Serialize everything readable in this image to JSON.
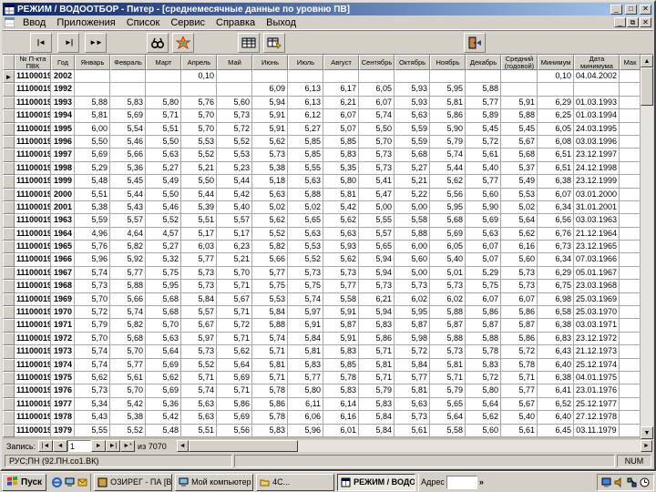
{
  "window": {
    "title": "РЕЖИМ / ВОДООТБОР - Питер - [среднемесячные данные по уровню ПВ]"
  },
  "menu": {
    "items": [
      {
        "label": "Ввод",
        "name": "vvod"
      },
      {
        "label": "Приложения",
        "name": "prilozheniya"
      },
      {
        "label": "Список",
        "name": "spisok"
      },
      {
        "label": "Сервис",
        "name": "servis"
      },
      {
        "label": "Справка",
        "name": "spravka"
      },
      {
        "label": "Выход",
        "name": "vykhod"
      }
    ]
  },
  "toolbar": {
    "buttons": [
      {
        "name": "first-record"
      },
      {
        "name": "last-record"
      },
      {
        "name": "fast-forward"
      },
      {
        "name": "find"
      },
      {
        "name": "wizard"
      },
      {
        "name": "table"
      },
      {
        "name": "query"
      },
      {
        "name": "exit"
      }
    ]
  },
  "grid": {
    "headers": [
      "",
      "№ П-кта ПВК",
      "Год",
      "Январь",
      "Февраль",
      "Март",
      "Апрель",
      "Май",
      "Июнь",
      "Июль",
      "Август",
      "Сентябрь",
      "Октябрь",
      "Ноябрь",
      "Декабрь",
      "Средний (годовой)",
      "Минимум",
      "Дата минимума",
      "Мак"
    ],
    "current_row_index": 0,
    "rows": [
      {
        "num": "11100019",
        "year": "2002",
        "m": [
          "",
          "",
          "",
          "0,10",
          "",
          "",
          "",
          "",
          "",
          "",
          "",
          ""
        ],
        "avg": "",
        "min": "0,10",
        "date": "04.04.2002",
        "mak": ""
      },
      {
        "num": "11100019",
        "year": "1992",
        "m": [
          "",
          "",
          "",
          "",
          "",
          "6,09",
          "6,13",
          "6,17",
          "6,05",
          "5,93",
          "5,95",
          "5,88"
        ],
        "avg": "",
        "min": "",
        "date": "",
        "mak": ""
      },
      {
        "num": "11100019",
        "year": "1993",
        "m": [
          "5,88",
          "5,83",
          "5,80",
          "5,76",
          "5,60",
          "5,94",
          "6,13",
          "6,21",
          "6,07",
          "5,93",
          "5,81",
          "5,77"
        ],
        "avg": "5,91",
        "min": "6,29",
        "date": "01.03.1993",
        "mak": ""
      },
      {
        "num": "11100019",
        "year": "1994",
        "m": [
          "5,81",
          "5,69",
          "5,71",
          "5,70",
          "5,73",
          "5,91",
          "6,12",
          "6,07",
          "5,74",
          "5,63",
          "5,86",
          "5,89"
        ],
        "avg": "5,88",
        "min": "6,25",
        "date": "01.03.1994",
        "mak": ""
      },
      {
        "num": "11100019",
        "year": "1995",
        "m": [
          "6,00",
          "5,54",
          "5,51",
          "5,70",
          "5,72",
          "5,91",
          "5,27",
          "5,07",
          "5,50",
          "5,59",
          "5,90",
          "5,45"
        ],
        "avg": "5,45",
        "min": "6,05",
        "date": "24.03.1995",
        "mak": ""
      },
      {
        "num": "11100019",
        "year": "1996",
        "m": [
          "5,50",
          "5,46",
          "5,50",
          "5,53",
          "5,52",
          "5,62",
          "5,85",
          "5,85",
          "5,70",
          "5,59",
          "5,79",
          "5,72"
        ],
        "avg": "5,67",
        "min": "6,08",
        "date": "03.03.1996",
        "mak": ""
      },
      {
        "num": "11100019",
        "year": "1997",
        "m": [
          "5,69",
          "5,66",
          "5,63",
          "5,52",
          "5,53",
          "5,73",
          "5,85",
          "5,83",
          "5,73",
          "5,68",
          "5,74",
          "5,61"
        ],
        "avg": "5,68",
        "min": "6,51",
        "date": "23.12.1997",
        "mak": ""
      },
      {
        "num": "11100019",
        "year": "1998",
        "m": [
          "5,29",
          "5,36",
          "5,27",
          "5,21",
          "5,23",
          "5,38",
          "5,55",
          "5,35",
          "5,73",
          "5,27",
          "5,44",
          "5,40"
        ],
        "avg": "5,37",
        "min": "6,51",
        "date": "24.12.1998",
        "mak": ""
      },
      {
        "num": "11100019",
        "year": "1999",
        "m": [
          "5,48",
          "5,45",
          "5,49",
          "5,50",
          "5,44",
          "5,18",
          "5,63",
          "5,80",
          "5,41",
          "5,21",
          "5,62",
          "5,77"
        ],
        "avg": "5,49",
        "min": "6,38",
        "date": "23.12.1999",
        "mak": ""
      },
      {
        "num": "11100019",
        "year": "2000",
        "m": [
          "5,51",
          "5,44",
          "5,50",
          "5,44",
          "5,42",
          "5,63",
          "5,88",
          "5,81",
          "5,47",
          "5,22",
          "5,56",
          "5,60"
        ],
        "avg": "5,53",
        "min": "6,07",
        "date": "03.01.2000",
        "mak": ""
      },
      {
        "num": "11100019",
        "year": "2001",
        "m": [
          "5,38",
          "5,43",
          "5,46",
          "5,39",
          "5,40",
          "5,02",
          "5,02",
          "5,42",
          "5,00",
          "5,00",
          "5,95",
          "5,90"
        ],
        "avg": "5,02",
        "min": "6,34",
        "date": "31.01.2001",
        "mak": ""
      },
      {
        "num": "11100019",
        "year": "1963",
        "m": [
          "5,59",
          "5,57",
          "5,52",
          "5,51",
          "5,57",
          "5,62",
          "5,65",
          "5,62",
          "5,55",
          "5,58",
          "5,68",
          "5,69"
        ],
        "avg": "5,64",
        "min": "6,56",
        "date": "03.03.1963",
        "mak": ""
      },
      {
        "num": "11100019",
        "year": "1964",
        "m": [
          "4,96",
          "4,64",
          "4,57",
          "5,17",
          "5,17",
          "5,52",
          "5,63",
          "5,63",
          "5,57",
          "5,88",
          "5,69",
          "5,63"
        ],
        "avg": "5,62",
        "min": "6,76",
        "date": "21.12.1964",
        "mak": ""
      },
      {
        "num": "11100019",
        "year": "1965",
        "m": [
          "5,76",
          "5,82",
          "5,27",
          "6,03",
          "6,23",
          "5,82",
          "5,53",
          "5,93",
          "5,65",
          "6,00",
          "6,05",
          "6,07"
        ],
        "avg": "6,16",
        "min": "6,73",
        "date": "23.12.1965",
        "mak": ""
      },
      {
        "num": "11100019",
        "year": "1966",
        "m": [
          "5,96",
          "5,92",
          "5,32",
          "5,77",
          "5,21",
          "5,66",
          "5,52",
          "5,62",
          "5,94",
          "5,60",
          "5,40",
          "5,07"
        ],
        "avg": "5,60",
        "min": "6,34",
        "date": "07.03.1966",
        "mak": ""
      },
      {
        "num": "11100019",
        "year": "1967",
        "m": [
          "5,74",
          "5,77",
          "5,75",
          "5,73",
          "5,70",
          "5,77",
          "5,73",
          "5,73",
          "5,94",
          "5,00",
          "5,01",
          "5,29"
        ],
        "avg": "5,73",
        "min": "6,29",
        "date": "05.01.1967",
        "mak": ""
      },
      {
        "num": "11100019",
        "year": "1968",
        "m": [
          "5,73",
          "5,88",
          "5,95",
          "5,73",
          "5,71",
          "5,75",
          "5,75",
          "5,77",
          "5,73",
          "5,73",
          "5,73",
          "5,75"
        ],
        "avg": "5,73",
        "min": "6,75",
        "date": "23.03.1968",
        "mak": ""
      },
      {
        "num": "11100019",
        "year": "1969",
        "m": [
          "5,70",
          "5,66",
          "5,68",
          "5,84",
          "5,67",
          "5,53",
          "5,74",
          "5,58",
          "6,21",
          "6,02",
          "6,02",
          "6,07"
        ],
        "avg": "6,07",
        "min": "6,98",
        "date": "25.03.1969",
        "mak": ""
      },
      {
        "num": "11100019",
        "year": "1970",
        "m": [
          "5,72",
          "5,74",
          "5,68",
          "5,57",
          "5,71",
          "5,84",
          "5,97",
          "5,91",
          "5,94",
          "5,95",
          "5,88",
          "5,86"
        ],
        "avg": "5,86",
        "min": "6,58",
        "date": "25.03.1970",
        "mak": ""
      },
      {
        "num": "11100019",
        "year": "1971",
        "m": [
          "5,79",
          "5,82",
          "5,70",
          "5,67",
          "5,72",
          "5,88",
          "5,91",
          "5,87",
          "5,83",
          "5,87",
          "5,87",
          "5,87"
        ],
        "avg": "5,87",
        "min": "6,38",
        "date": "03.03.1971",
        "mak": ""
      },
      {
        "num": "11100019",
        "year": "1972",
        "m": [
          "5,70",
          "5,68",
          "5,63",
          "5,97",
          "5,71",
          "5,74",
          "5,84",
          "5,91",
          "5,86",
          "5,98",
          "5,88",
          "5,88"
        ],
        "avg": "5,86",
        "min": "6,83",
        "date": "23.12.1972",
        "mak": ""
      },
      {
        "num": "11100019",
        "year": "1973",
        "m": [
          "5,74",
          "5,70",
          "5,64",
          "5,73",
          "5,62",
          "5,71",
          "5,81",
          "5,83",
          "5,71",
          "5,72",
          "5,73",
          "5,78"
        ],
        "avg": "5,72",
        "min": "6,43",
        "date": "21.12.1973",
        "mak": ""
      },
      {
        "num": "11100019",
        "year": "1974",
        "m": [
          "5,74",
          "5,77",
          "5,69",
          "5,52",
          "5,64",
          "5,81",
          "5,83",
          "5,85",
          "5,81",
          "5,84",
          "5,81",
          "5,83"
        ],
        "avg": "5,78",
        "min": "6,40",
        "date": "25.12.1974",
        "mak": ""
      },
      {
        "num": "11100019",
        "year": "1975",
        "m": [
          "5,62",
          "5,61",
          "5,62",
          "5,71",
          "5,69",
          "5,71",
          "5,77",
          "5,78",
          "5,71",
          "5,77",
          "5,71",
          "5,72"
        ],
        "avg": "5,71",
        "min": "6,38",
        "date": "04.01.1975",
        "mak": ""
      },
      {
        "num": "11100019",
        "year": "1976",
        "m": [
          "5,73",
          "5,70",
          "5,69",
          "5,74",
          "5,71",
          "5,78",
          "5,80",
          "5,83",
          "5,79",
          "5,81",
          "5,79",
          "5,80"
        ],
        "avg": "5,77",
        "min": "6,41",
        "date": "23.01.1976",
        "mak": ""
      },
      {
        "num": "11100019",
        "year": "1977",
        "m": [
          "5,34",
          "5,42",
          "5,36",
          "5,63",
          "5,86",
          "5,86",
          "6,11",
          "6,14",
          "5,83",
          "5,63",
          "5,65",
          "5,64"
        ],
        "avg": "5,67",
        "min": "6,52",
        "date": "25.12.1977",
        "mak": ""
      },
      {
        "num": "11100019",
        "year": "1978",
        "m": [
          "5,43",
          "5,38",
          "5,42",
          "5,63",
          "5,69",
          "5,78",
          "6,06",
          "6,16",
          "5,84",
          "5,73",
          "5,64",
          "5,62"
        ],
        "avg": "5,40",
        "min": "6,40",
        "date": "27.12.1978",
        "mak": ""
      },
      {
        "num": "11100019",
        "year": "1979",
        "m": [
          "5,55",
          "5,52",
          "5,48",
          "5,51",
          "5,56",
          "5,83",
          "5,96",
          "6,01",
          "5,84",
          "5,61",
          "5,58",
          "5,60"
        ],
        "avg": "5,61",
        "min": "6,45",
        "date": "03.11.1979",
        "mak": ""
      }
    ]
  },
  "navigator": {
    "label": "Запись:",
    "value": "1",
    "count": "из 7070"
  },
  "statusbar": {
    "message": "РУС;ПН (92.ПН.со1.ВК)",
    "num": "NUM"
  },
  "taskbar": {
    "start": "Пуск",
    "address_label": "Адрес",
    "tasks": [
      {
        "label": "ОЗИРЕГ - ПА [ВИ",
        "name": "ozireg",
        "active": false
      },
      {
        "label": "Мой компьютер",
        "name": "my-computer",
        "active": false
      },
      {
        "label": "4С...",
        "name": "4c",
        "active": false
      },
      {
        "label": "РЕЖИМ / ВОДО...",
        "name": "rezhim-vodootbor",
        "active": true
      }
    ]
  }
}
